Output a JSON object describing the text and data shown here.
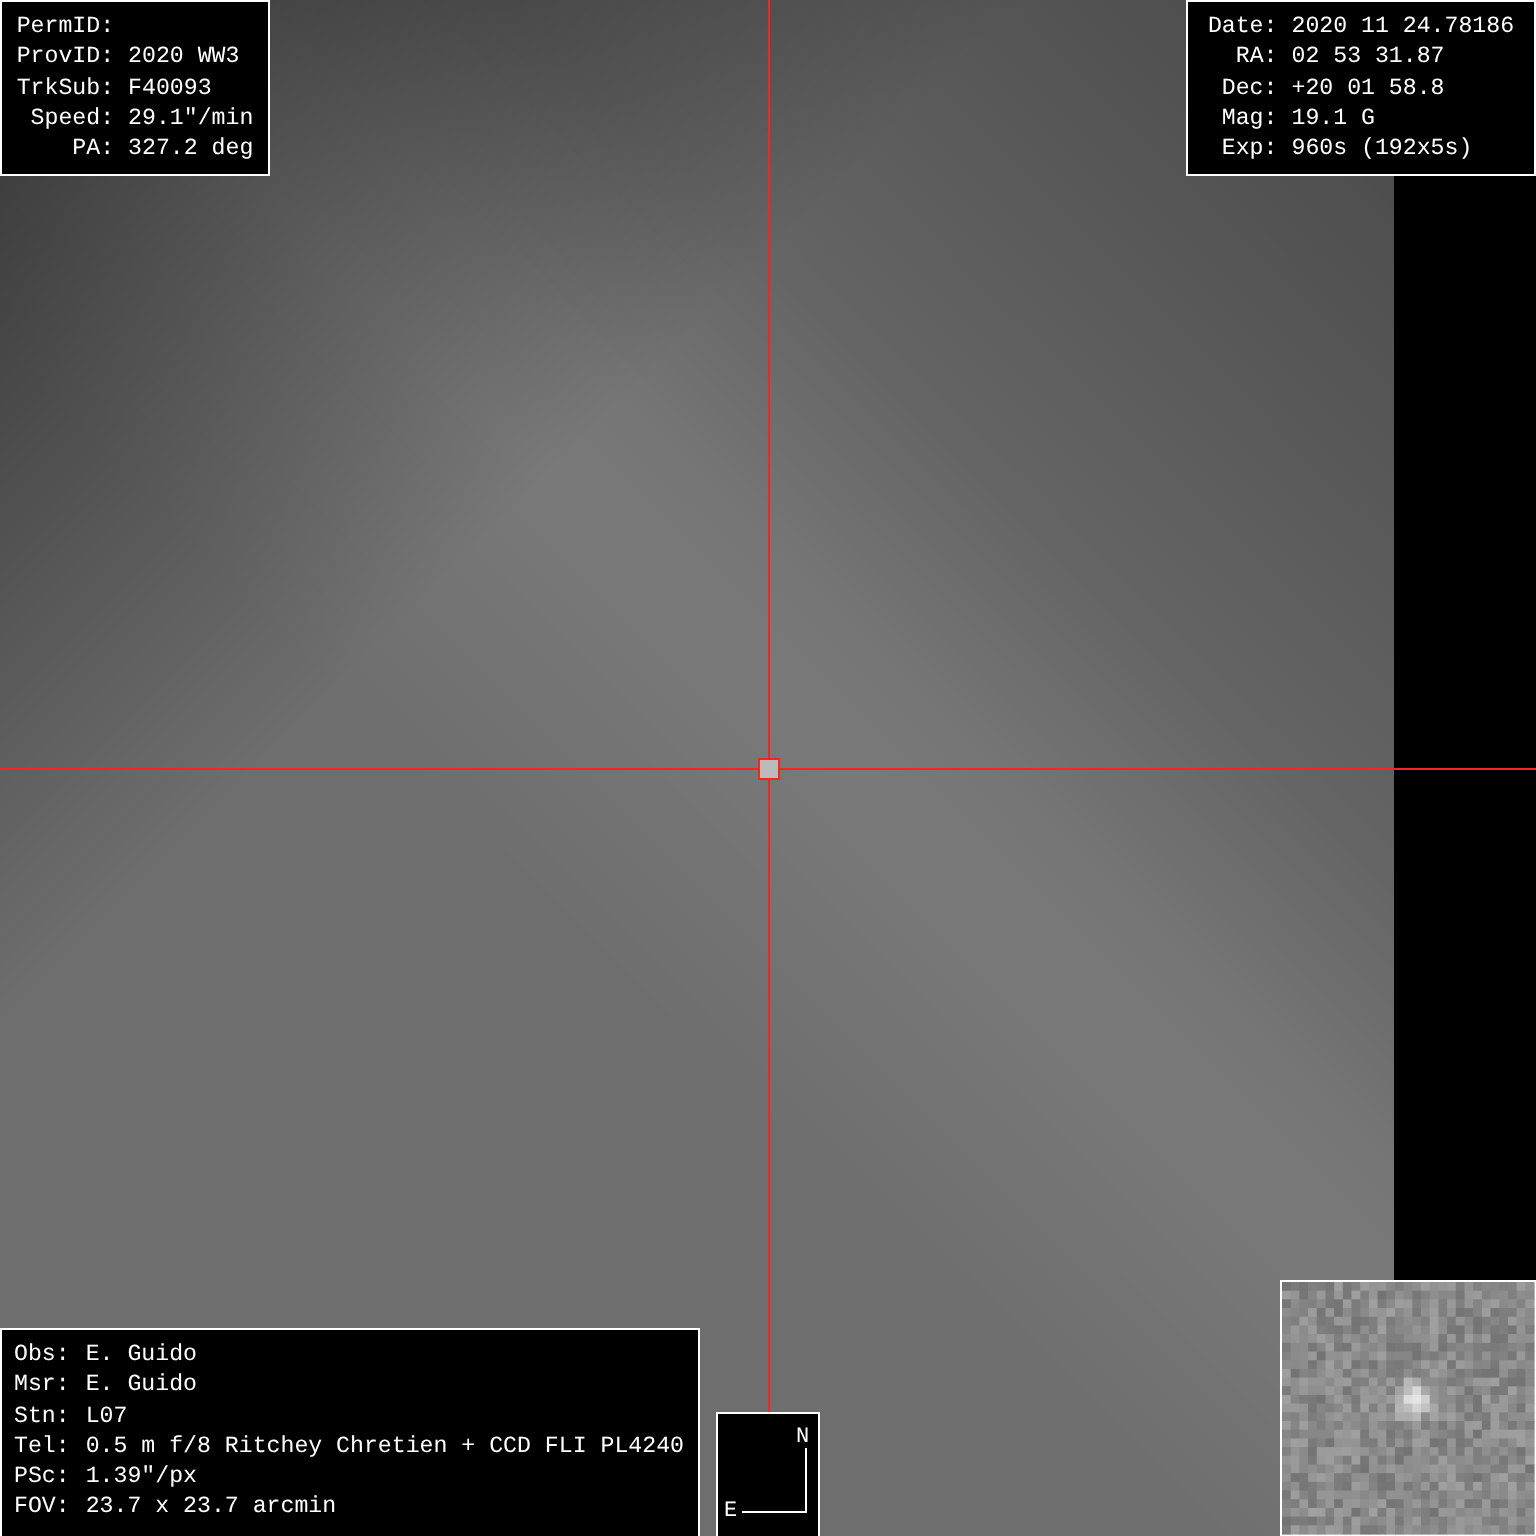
{
  "object_panel": [
    {
      "label": "PermID:"
    },
    {
      "label": "ProvID:",
      "value": "2020 WW3"
    },
    {
      "label": "TrkSub:",
      "value": "F40093"
    },
    {
      "label": "Speed:",
      "value": "29.1\"/min"
    },
    {
      "label": "PA:",
      "value": "327.2 deg"
    }
  ],
  "observation_panel": [
    {
      "label": "Date:",
      "value": "2020 11 24.78186"
    },
    {
      "label": "RA:",
      "value": "02 53 31.87"
    },
    {
      "label": "Dec:",
      "value": "+20 01 58.8"
    },
    {
      "label": "Mag:",
      "value": "19.1 G"
    },
    {
      "label": "Exp:",
      "value": "960s (192x5s)"
    }
  ],
  "station_panel": [
    {
      "label": "Obs:",
      "value": "E. Guido"
    },
    {
      "label": "Msr:",
      "value": "E. Guido"
    },
    {
      "label": "Stn:",
      "value": "L07"
    },
    {
      "label": "Tel:",
      "value": "0.5 m f/8 Ritchey Chretien + CCD FLI PL4240"
    },
    {
      "label": "PSc:",
      "value": "1.39\"/px"
    },
    {
      "label": "FOV:",
      "value": "23.7 x 23.7 arcmin"
    }
  ],
  "compass": {
    "north": "N",
    "east": "E"
  }
}
